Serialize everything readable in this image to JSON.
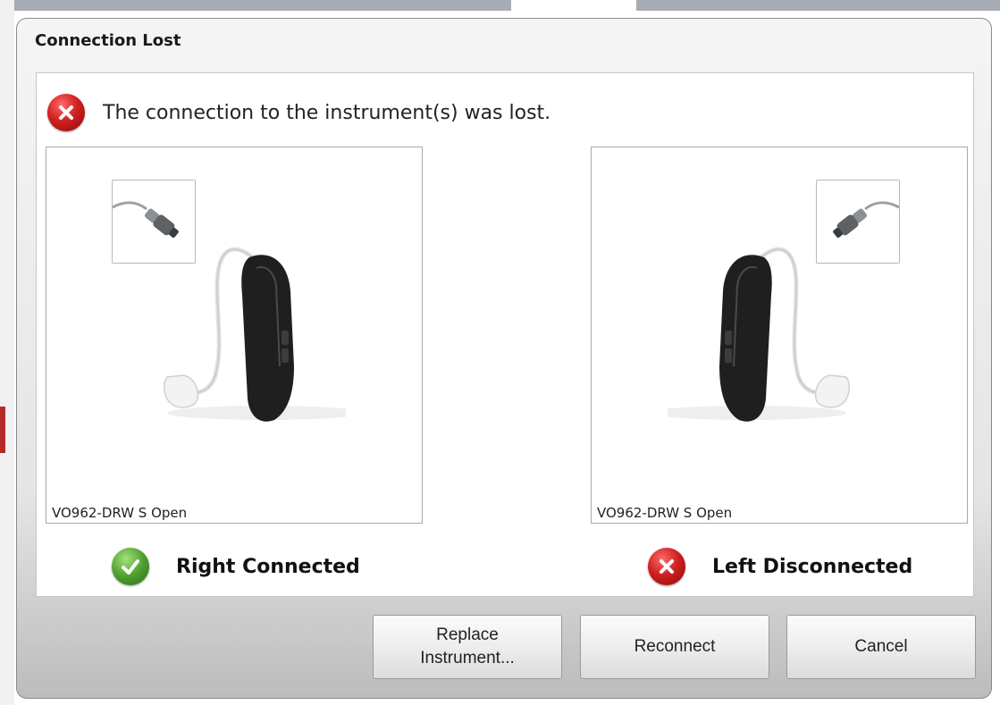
{
  "dialog": {
    "title": "Connection Lost",
    "message": "The connection to the instrument(s) was lost."
  },
  "panels": [
    {
      "model": "VO962-DRW S Open",
      "side": "right"
    },
    {
      "model": "VO962-DRW S Open",
      "side": "left"
    }
  ],
  "status": {
    "right_label": "Right Connected",
    "left_label": "Left Disconnected"
  },
  "buttons": {
    "replace": "Replace\nInstrument...",
    "reconnect": "Reconnect",
    "cancel": "Cancel"
  },
  "colors": {
    "error": "#d02020",
    "success": "#4e9f2f",
    "device": "#1f1f1f"
  },
  "icons": {
    "message": "error-x-icon",
    "right_status": "checkmark-icon",
    "left_status": "error-x-icon",
    "plug": "programming-cable-icon",
    "device": "hearing-aid-image"
  }
}
